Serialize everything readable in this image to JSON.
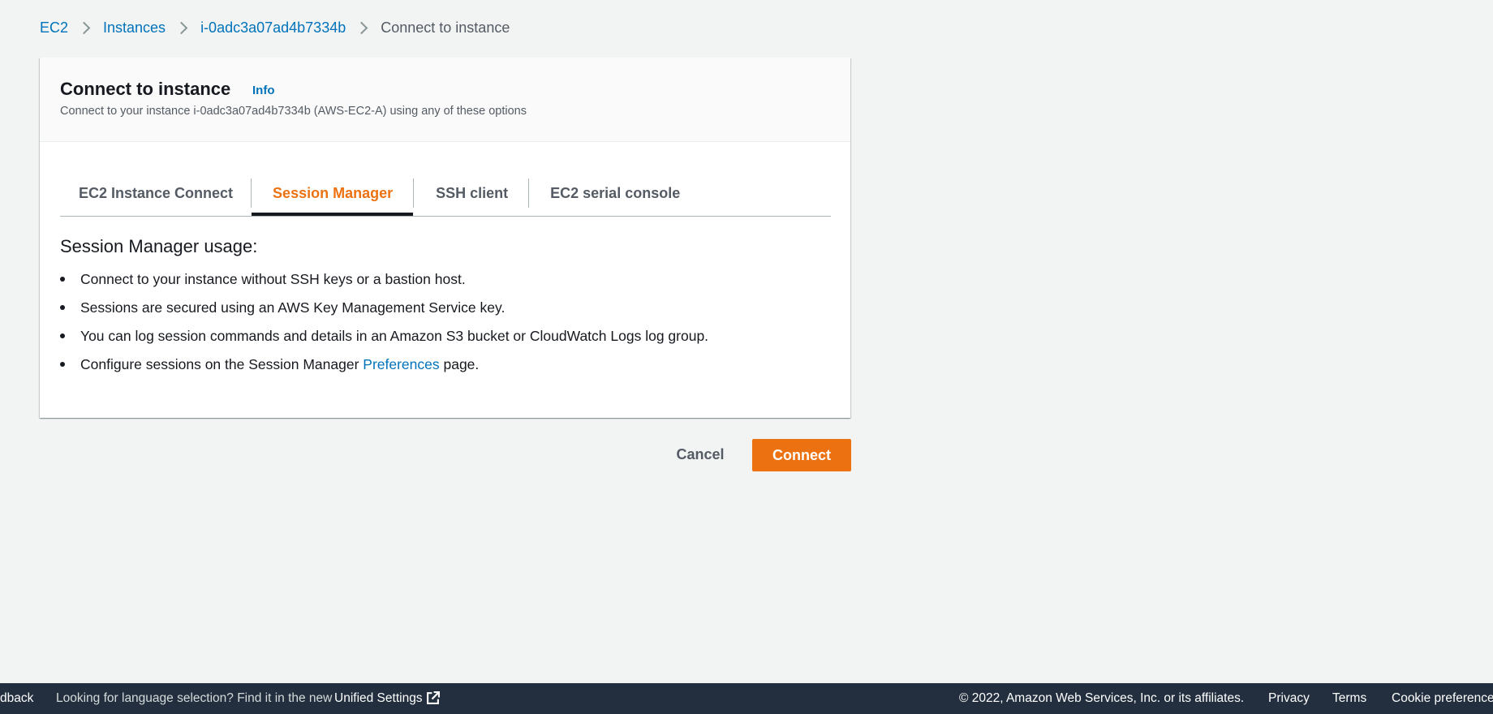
{
  "breadcrumb": {
    "items": [
      "EC2",
      "Instances",
      "i-0adc3a07ad4b7334b"
    ],
    "current": "Connect to instance"
  },
  "panel": {
    "title": "Connect to instance",
    "info_label": "Info",
    "description": "Connect to your instance i-0adc3a07ad4b7334b (AWS-EC2-A) using any of these options"
  },
  "tabs": [
    {
      "label": "EC2 Instance Connect",
      "active": false
    },
    {
      "label": "Session Manager",
      "active": true
    },
    {
      "label": "SSH client",
      "active": false
    },
    {
      "label": "EC2 serial console",
      "active": false
    }
  ],
  "usage": {
    "title": "Session Manager usage:",
    "items": [
      "Connect to your instance without SSH keys or a bastion host.",
      "Sessions are secured using an AWS Key Management Service key.",
      "You can log session commands and details in an Amazon S3 bucket or CloudWatch Logs log group."
    ],
    "last_item": {
      "prefix": "Configure sessions on the Session Manager ",
      "link": "Preferences",
      "suffix": " page."
    }
  },
  "actions": {
    "cancel_label": "Cancel",
    "connect_label": "Connect"
  },
  "footer": {
    "feedback": "dback",
    "language_prompt": "Looking for language selection? Find it in the new",
    "unified_settings": "Unified Settings",
    "copyright": "© 2022, Amazon Web Services, Inc. or its affiliates.",
    "privacy": "Privacy",
    "terms": "Terms",
    "cookie": "Cookie preferences"
  },
  "colors": {
    "accent": "#ec7211",
    "link": "#0073bb",
    "footer_bg": "#232f3e"
  }
}
